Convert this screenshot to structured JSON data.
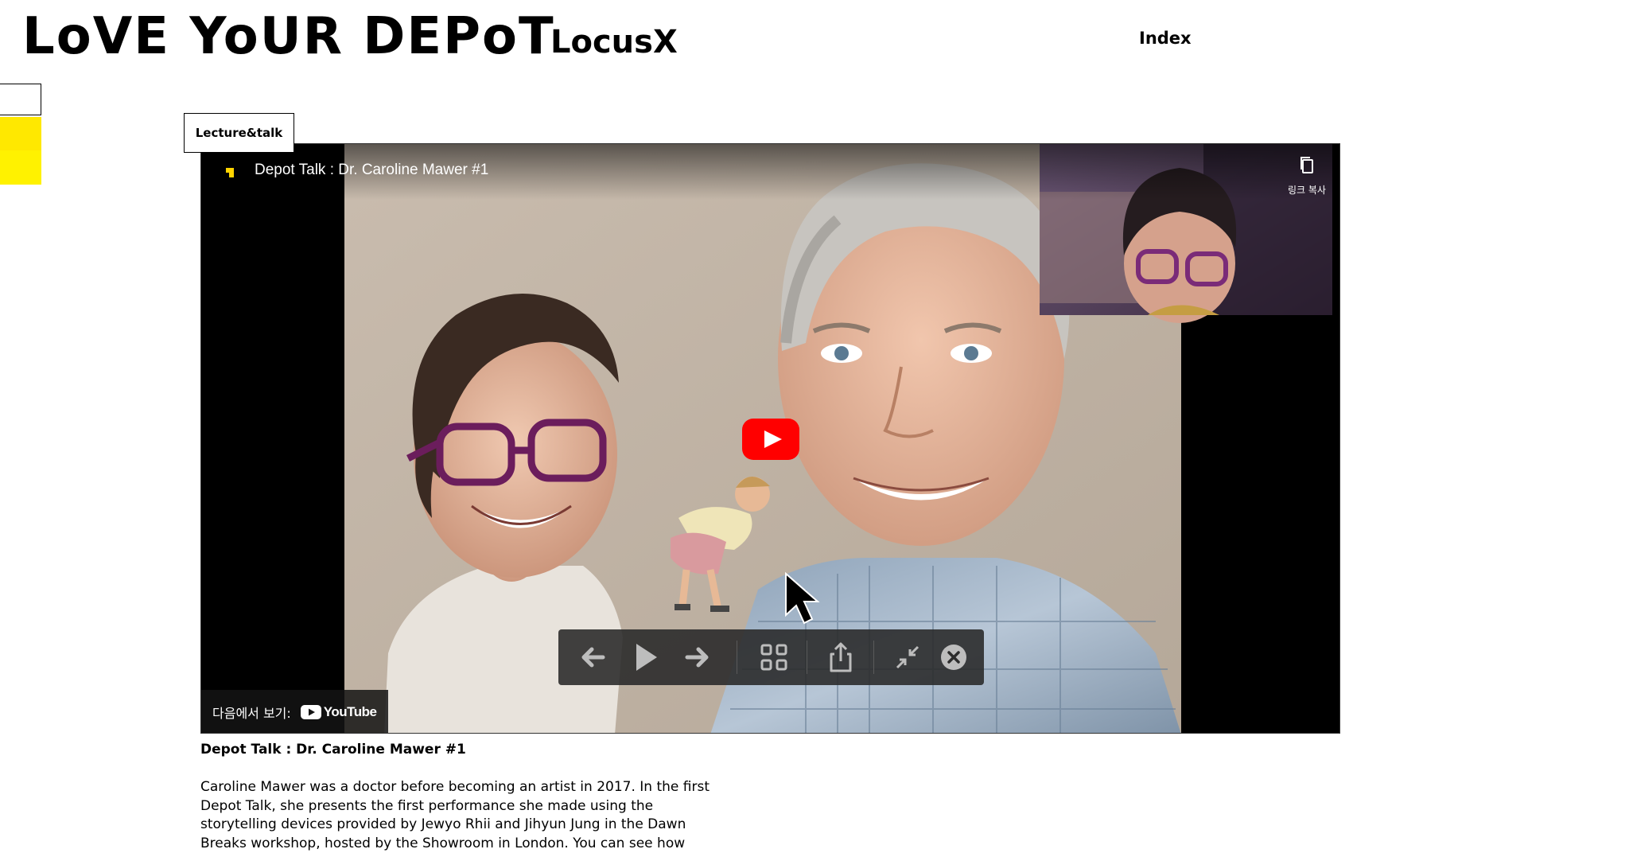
{
  "header": {
    "brand": "LoVE YoUR DEPoT",
    "sub_brand": "LocusX",
    "index_label": "Index"
  },
  "category_tag": "Lecture&talk",
  "video": {
    "title": "Depot Talk : Dr. Caroline Mawer #1",
    "copy_link_label": "링크 복사",
    "watch_on_label": "다음에서 보기:",
    "platform": "YouTube",
    "icons": [
      "channel-icon",
      "copy-icon",
      "play-icon",
      "arrow-left-icon",
      "play-control-icon",
      "arrow-right-icon",
      "grid-icon",
      "share-icon",
      "minimize-icon",
      "close-icon",
      "youtube-logo"
    ],
    "colors": {
      "play_button": "#ff0000",
      "channel_icon": "#ffd400"
    }
  },
  "post": {
    "caption": "Depot Talk : Dr. Caroline Mawer #1",
    "description": "Caroline Mawer was a doctor before becoming an artist in 2017. In the first Depot Talk, she presents the first performance she made using the storytelling devices provided by Jewyo Rhii and Jihyun Jung in the Dawn Breaks workshop, hosted by the Showroom in London. You can see how"
  },
  "side_colors": {
    "yellow_1": "#ffe800",
    "yellow_2": "#fff200"
  }
}
